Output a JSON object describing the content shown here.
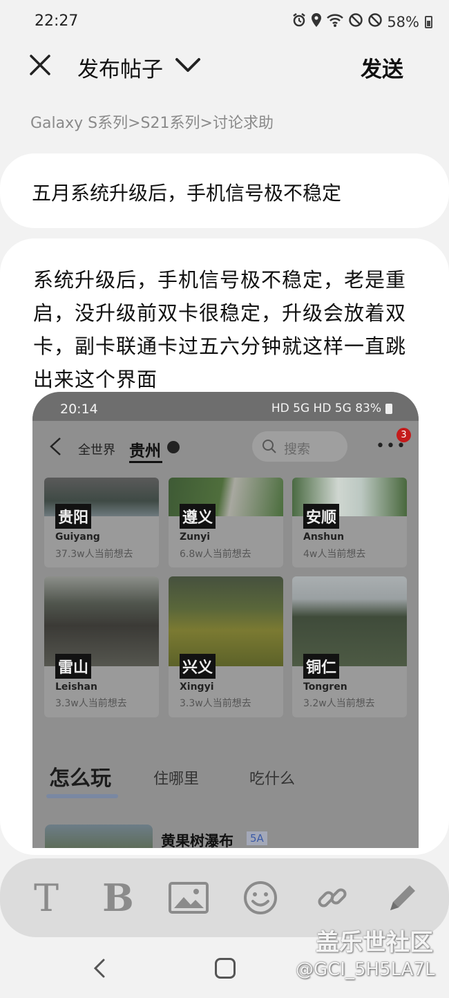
{
  "status": {
    "time": "22:27",
    "battery": "58%",
    "icons": [
      "alarm-icon",
      "location-icon",
      "wifi-icon",
      "dnd-icon",
      "block-icon",
      "battery-icon"
    ]
  },
  "appbar": {
    "title": "发布帖子",
    "send_label": "发送"
  },
  "breadcrumb": "Galaxy S系列>S21系列>讨论求助",
  "subject": "五月系统升级后，手机信号极不稳定",
  "body_text": "系统升级后，手机信号极不稳定，老是重启，没升级前双卡很稳定，升级会放着双卡，副卡联通卡过五六分钟就这样一直跳出来这个界面",
  "embedded": {
    "time": "20:14",
    "status_right": "HD 5G HD 5G 83%",
    "nav": {
      "tab_world": "全世界",
      "tab_region": "贵州",
      "search_placeholder": "搜索",
      "badge": "3"
    },
    "cities": [
      {
        "cn": "贵阳",
        "en": "Guiyang",
        "count": "37.3w人当前想去"
      },
      {
        "cn": "遵义",
        "en": "Zunyi",
        "count": "6.8w人当前想去"
      },
      {
        "cn": "安顺",
        "en": "Anshun",
        "count": "4w人当前想去"
      },
      {
        "cn": "雷山",
        "en": "Leishan",
        "count": "3.3w人当前想去"
      },
      {
        "cn": "兴义",
        "en": "Xingyi",
        "count": "3.3w人当前想去"
      },
      {
        "cn": "铜仁",
        "en": "Tongren",
        "count": "3.2w人当前想去"
      }
    ],
    "tabs": [
      "怎么玩",
      "住哪里",
      "吃什么"
    ],
    "spot_name": "黄果树瀑布",
    "spot_grade": "5A"
  },
  "toolbar": {
    "text_label": "T",
    "bold_label": "B",
    "tools": [
      "text-icon",
      "bold-icon",
      "image-icon",
      "emoji-icon",
      "link-icon",
      "pen-icon"
    ]
  },
  "watermark": {
    "line1": "盖乐世社区",
    "line2": "@GCI_5H5LA7L"
  },
  "colors": {
    "background": "#f2f2f2",
    "card": "#ffffff",
    "toolbar": "#dcdcdc",
    "badge": "#c41b1b"
  }
}
